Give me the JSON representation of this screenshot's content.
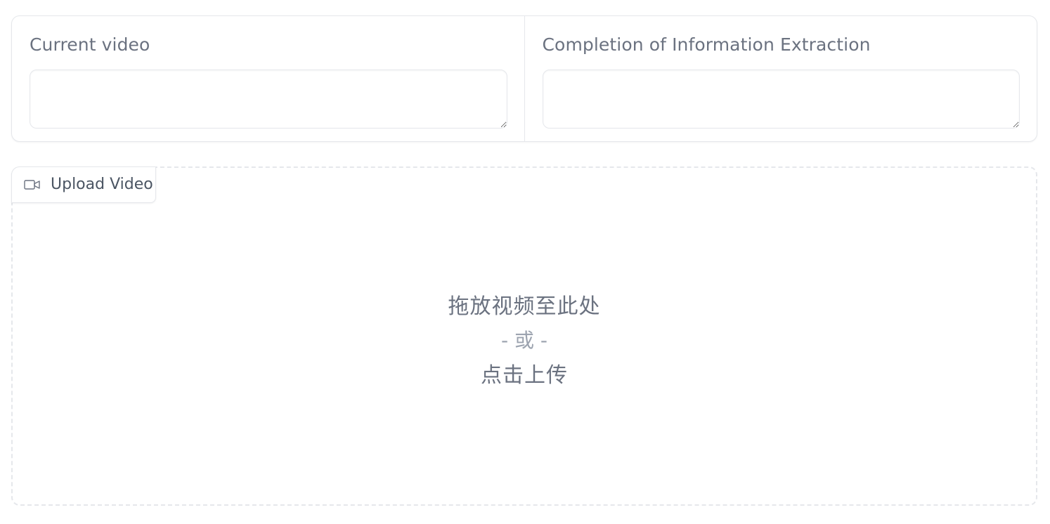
{
  "fields": {
    "current_video": {
      "label": "Current video",
      "value": ""
    },
    "completion": {
      "label": "Completion of Information Extraction",
      "value": ""
    }
  },
  "upload": {
    "tab_label": "Upload Video",
    "icon": "video-camera-icon",
    "drop_text": "拖放视频至此处",
    "or_text": "- 或 -",
    "click_text": "点击上传"
  },
  "colors": {
    "border": "#e5e7eb",
    "label_text": "#6b7280",
    "muted_text": "#9ca3af"
  }
}
